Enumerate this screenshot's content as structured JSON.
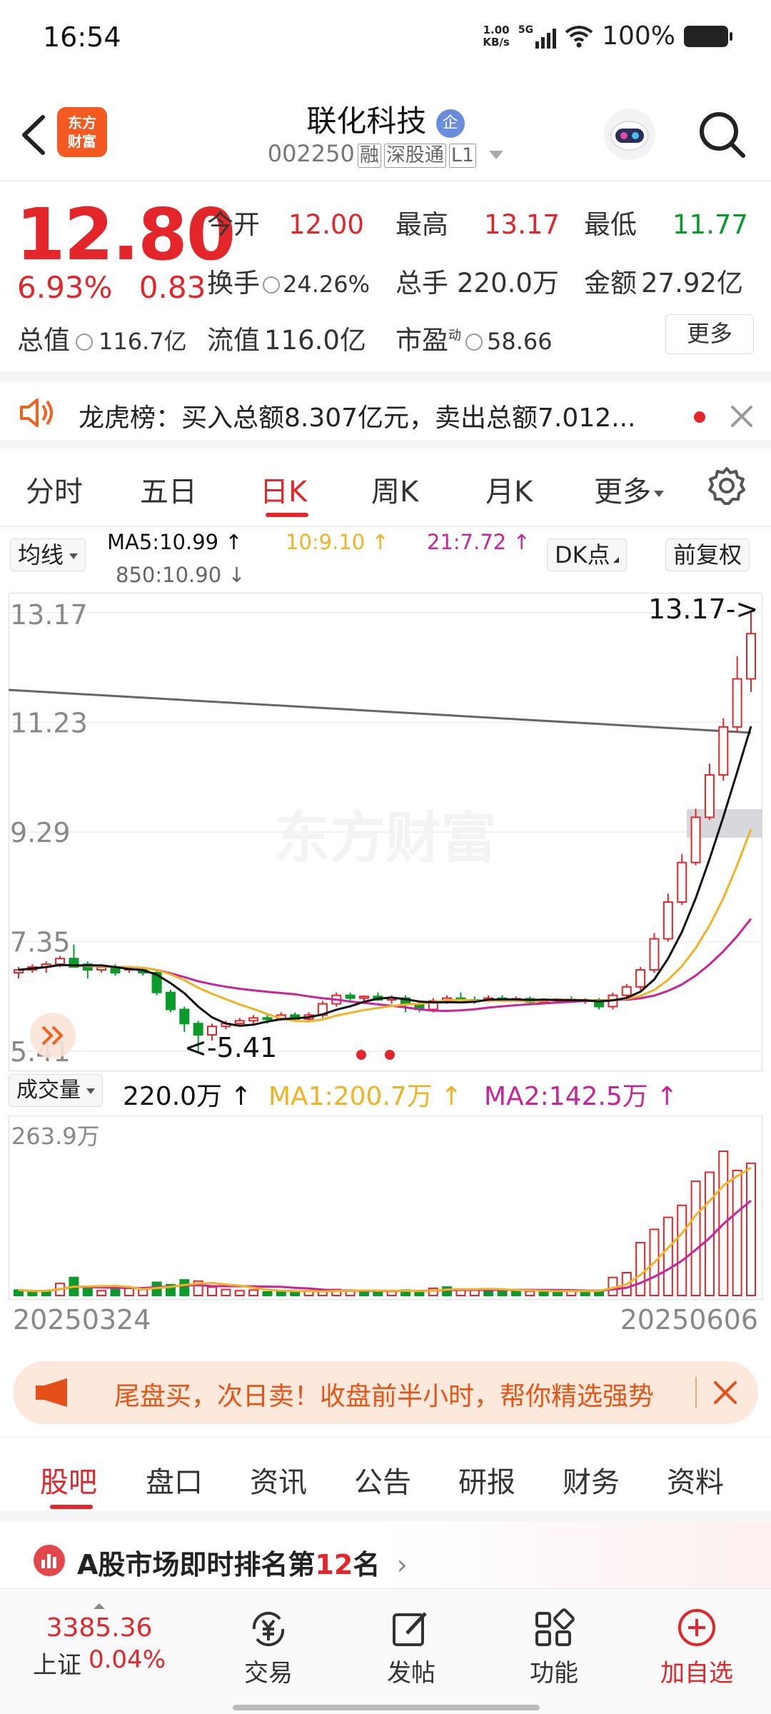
{
  "status_bar": {
    "time": "16:54",
    "net_speed_value": "1.00",
    "net_speed_unit": "KB/s",
    "network": "5G",
    "battery": "100%"
  },
  "header": {
    "brand_line1": "东方",
    "brand_line2": "财富",
    "stock_name": "联化科技",
    "name_badge": "企",
    "stock_code": "002250",
    "tags": [
      "融",
      "深股通",
      "L1"
    ]
  },
  "quote": {
    "price": "12.80",
    "change_pct": "6.93%",
    "change_amt": "0.83",
    "open_label": "今开",
    "open": "12.00",
    "high_label": "最高",
    "high": "13.17",
    "low_label": "最低",
    "low": "11.77",
    "turnover_label": "换手",
    "turnover": "24.26%",
    "volume_label": "总手",
    "volume": "220.0万",
    "amount_label": "金额",
    "amount": "27.92亿",
    "mktcap_label": "总值",
    "mktcap": "116.7亿",
    "float_label": "流值",
    "float": "116.0亿",
    "pe_label": "市盈",
    "pe_sup": "动",
    "pe": "58.66",
    "more": "更多"
  },
  "notice": {
    "text": "龙虎榜：买入总额8.307亿元，卖出总额7.012..."
  },
  "kline_tabs": [
    "分时",
    "五日",
    "日K",
    "周K",
    "月K",
    "更多"
  ],
  "ma_row": {
    "selector": "均线",
    "ma5": "MA5:10.99 ↑",
    "ma10": "10:9.10 ↑",
    "ma21": "21:7.72 ↑",
    "ma850": "850:10.90 ↓",
    "dk_btn": "DK点",
    "adjust_btn": "前复权"
  },
  "kchart": {
    "y_labels": [
      "13.17",
      "11.23",
      "9.29",
      "7.35",
      "5.41"
    ],
    "high_marker": "13.17->",
    "low_marker": "<-5.41",
    "watermark": "东方财富"
  },
  "volume": {
    "selector": "成交量",
    "vol": "220.0万 ↑",
    "ma1": "MA1:200.7万 ↑",
    "ma2": "MA2:142.5万 ↑",
    "y_label": "263.9万"
  },
  "dates": {
    "start": "20250324",
    "end": "20250606"
  },
  "ad": {
    "text": "尾盘买，次日卖！收盘前半小时，帮你精选强势"
  },
  "info_tabs": [
    "股吧",
    "盘口",
    "资讯",
    "公告",
    "研报",
    "财务",
    "资料"
  ],
  "rank": {
    "prefix": "A股市场即时排名第",
    "number": "12",
    "suffix": "名"
  },
  "bottom_nav": {
    "index_value": "3385.36",
    "index_name": "上证",
    "index_change": "0.04%",
    "trade": "交易",
    "post": "发帖",
    "functions": "功能",
    "add_watch": "加自选"
  },
  "colors": {
    "up": "#e4262b",
    "down": "#0a9b2c",
    "ma5": "#111111",
    "ma10": "#f0b324",
    "ma21": "#c9249a"
  },
  "chart_data": {
    "type": "candlestick",
    "ylim": [
      5.41,
      13.17
    ],
    "candles": [
      [
        6.8,
        6.9,
        6.7,
        6.85
      ],
      [
        6.85,
        6.95,
        6.8,
        6.9
      ],
      [
        6.9,
        7.0,
        6.8,
        6.95
      ],
      [
        6.95,
        7.1,
        6.9,
        7.05
      ],
      [
        7.05,
        7.3,
        6.95,
        6.9
      ],
      [
        6.95,
        7.0,
        6.7,
        6.85
      ],
      [
        6.85,
        6.95,
        6.8,
        6.9
      ],
      [
        6.9,
        6.95,
        6.75,
        6.8
      ],
      [
        6.85,
        6.9,
        6.8,
        6.88
      ],
      [
        6.88,
        6.9,
        6.75,
        6.8
      ],
      [
        6.8,
        6.85,
        6.4,
        6.45
      ],
      [
        6.45,
        6.5,
        6.1,
        6.15
      ],
      [
        6.15,
        6.2,
        5.75,
        5.9
      ],
      [
        5.9,
        5.95,
        5.41,
        5.7
      ],
      [
        5.7,
        5.9,
        5.6,
        5.85
      ],
      [
        5.85,
        5.95,
        5.8,
        5.9
      ],
      [
        5.9,
        6.0,
        5.85,
        5.95
      ],
      [
        5.95,
        6.05,
        5.9,
        6.0
      ],
      [
        6.0,
        6.05,
        5.9,
        5.98
      ],
      [
        5.98,
        6.1,
        5.95,
        6.05
      ],
      [
        6.05,
        6.1,
        5.95,
        5.98
      ],
      [
        5.98,
        6.1,
        5.95,
        6.05
      ],
      [
        6.05,
        6.3,
        6.0,
        6.25
      ],
      [
        6.25,
        6.45,
        6.2,
        6.4
      ],
      [
        6.4,
        6.45,
        6.3,
        6.35
      ],
      [
        6.35,
        6.4,
        6.3,
        6.38
      ],
      [
        6.38,
        6.45,
        6.3,
        6.32
      ],
      [
        6.32,
        6.4,
        6.25,
        6.35
      ],
      [
        6.35,
        6.4,
        6.1,
        6.25
      ],
      [
        6.25,
        6.3,
        6.1,
        6.15
      ],
      [
        6.15,
        6.35,
        6.1,
        6.3
      ],
      [
        6.3,
        6.4,
        6.25,
        6.35
      ],
      [
        6.35,
        6.45,
        6.3,
        6.32
      ],
      [
        6.32,
        6.38,
        6.25,
        6.3
      ],
      [
        6.3,
        6.4,
        6.28,
        6.35
      ],
      [
        6.35,
        6.4,
        6.3,
        6.32
      ],
      [
        6.32,
        6.38,
        6.28,
        6.34
      ],
      [
        6.34,
        6.38,
        6.25,
        6.28
      ],
      [
        6.28,
        6.35,
        6.25,
        6.32
      ],
      [
        6.32,
        6.35,
        6.28,
        6.33
      ],
      [
        6.33,
        6.38,
        6.28,
        6.3
      ],
      [
        6.3,
        6.35,
        6.25,
        6.32
      ],
      [
        6.32,
        6.35,
        6.15,
        6.2
      ],
      [
        6.2,
        6.45,
        6.15,
        6.4
      ],
      [
        6.4,
        6.6,
        6.35,
        6.55
      ],
      [
        6.55,
        6.9,
        6.5,
        6.85
      ],
      [
        6.85,
        7.5,
        6.8,
        7.4
      ],
      [
        7.4,
        8.2,
        7.35,
        8.05
      ],
      [
        8.05,
        8.9,
        8.0,
        8.75
      ],
      [
        8.75,
        9.7,
        8.7,
        9.55
      ],
      [
        9.55,
        10.5,
        9.5,
        10.3
      ],
      [
        10.3,
        11.3,
        10.2,
        11.15
      ],
      [
        11.15,
        12.4,
        11.05,
        12.0
      ],
      [
        12.0,
        13.17,
        11.77,
        12.8
      ]
    ],
    "volumes": [
      [
        9,
        1
      ],
      [
        6,
        1
      ],
      [
        8,
        1
      ],
      [
        20,
        0
      ],
      [
        30,
        1
      ],
      [
        12,
        1
      ],
      [
        8,
        0
      ],
      [
        10,
        1
      ],
      [
        12,
        0
      ],
      [
        10,
        0
      ],
      [
        22,
        1
      ],
      [
        18,
        1
      ],
      [
        26,
        1
      ],
      [
        24,
        0
      ],
      [
        14,
        0
      ],
      [
        10,
        0
      ],
      [
        8,
        0
      ],
      [
        9,
        0
      ],
      [
        6,
        1
      ],
      [
        7,
        1
      ],
      [
        6,
        1
      ],
      [
        8,
        0
      ],
      [
        7,
        0
      ],
      [
        10,
        0
      ],
      [
        9,
        0
      ],
      [
        8,
        1
      ],
      [
        6,
        1
      ],
      [
        7,
        0
      ],
      [
        9,
        1
      ],
      [
        7,
        1
      ],
      [
        12,
        0
      ],
      [
        14,
        1
      ],
      [
        10,
        0
      ],
      [
        9,
        0
      ],
      [
        11,
        1
      ],
      [
        8,
        1
      ],
      [
        7,
        1
      ],
      [
        7,
        0
      ],
      [
        6,
        1
      ],
      [
        8,
        1
      ],
      [
        9,
        0
      ],
      [
        7,
        1
      ],
      [
        8,
        1
      ],
      [
        30,
        0
      ],
      [
        38,
        0
      ],
      [
        88,
        0
      ],
      [
        110,
        0
      ],
      [
        130,
        0
      ],
      [
        150,
        0
      ],
      [
        190,
        0
      ],
      [
        205,
        0
      ],
      [
        240,
        0
      ],
      [
        208,
        0
      ],
      [
        220,
        0
      ]
    ]
  }
}
